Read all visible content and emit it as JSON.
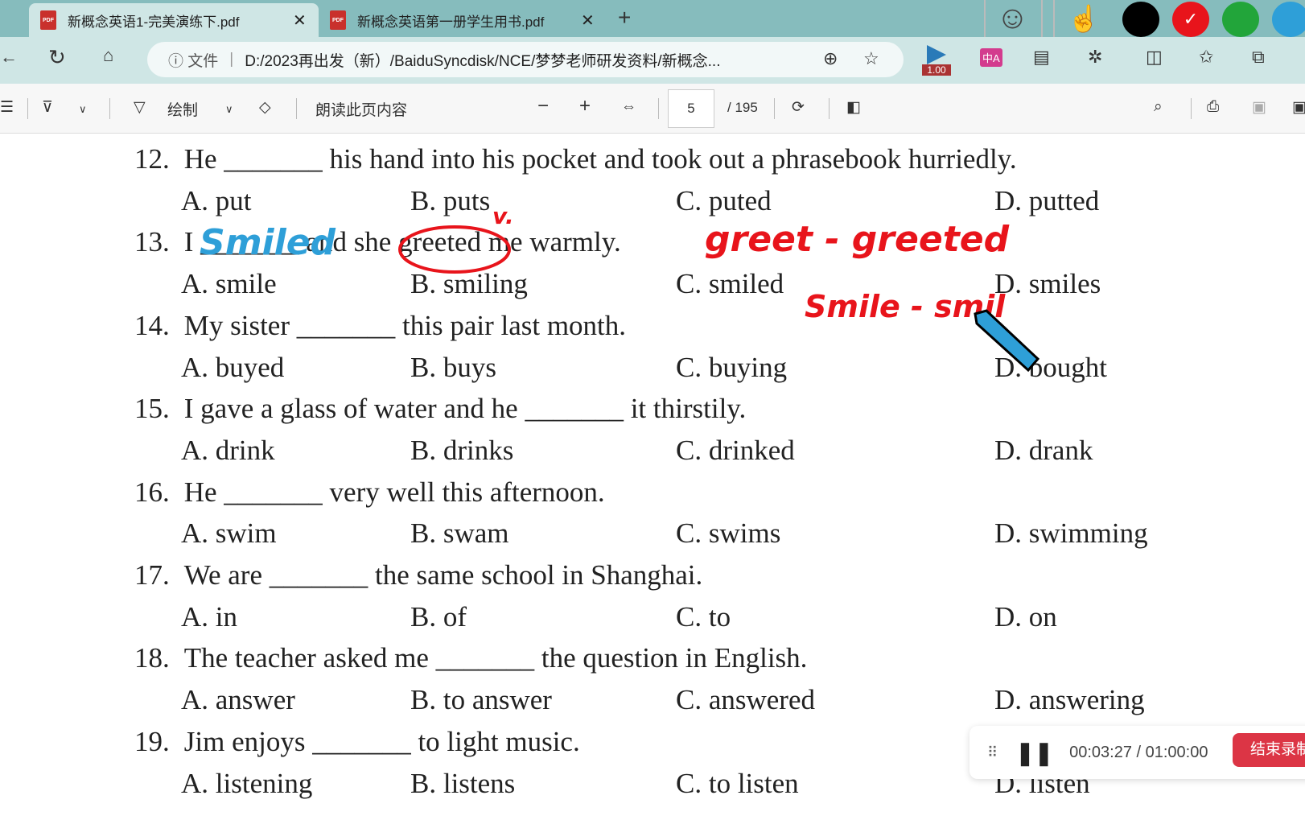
{
  "tabs": [
    {
      "label": "新概念英语1-完美演练下.pdf",
      "active": true
    },
    {
      "label": "新概念英语第一册学生用书.pdf",
      "active": false
    }
  ],
  "address": {
    "info": "文件",
    "url": "D:/2023再出发（新）/BaiduSyncdisk/NCE/梦梦老师研发资料/新概念...",
    "badge": "1.00"
  },
  "toolbar": {
    "draw": "绘制",
    "read_aloud": "朗读此页内容",
    "page": "5",
    "total": "/ 195"
  },
  "colors": {
    "pen_black": "#000000",
    "pen_red": "#e8141b",
    "pen_green": "#22a53a",
    "pen_blue": "#2e9fd8",
    "accent_red": "#dc3545"
  },
  "questions": [
    {
      "num": "12.",
      "stem": "He _______ his hand into his pocket and took out a phrasebook hurriedly.",
      "options": [
        "A. put",
        "B. puts",
        "C. puted",
        "D. putted"
      ]
    },
    {
      "num": "13.",
      "stem": "I _______ and she greeted me warmly.",
      "options": [
        "A. smile",
        "B. smiling",
        "C. smiled",
        "D. smiles"
      ]
    },
    {
      "num": "14.",
      "stem": "My sister _______ this pair last month.",
      "options": [
        "A. buyed",
        "B. buys",
        "C. buying",
        "D. bought"
      ]
    },
    {
      "num": "15.",
      "stem": "I gave a glass of water and he _______ it thirstily.",
      "options": [
        "A. drink",
        "B. drinks",
        "C. drinked",
        "D. drank"
      ]
    },
    {
      "num": "16.",
      "stem": "He _______ very well this afternoon.",
      "options": [
        "A. swim",
        "B. swam",
        "C. swims",
        "D. swimming"
      ]
    },
    {
      "num": "17.",
      "stem": "We are _______ the same school in Shanghai.",
      "options": [
        "A. in",
        "B. of",
        "C. to",
        "D. on"
      ]
    },
    {
      "num": "18.",
      "stem": "The teacher asked me _______ the question in English.",
      "options": [
        "A. answer",
        "B. to answer",
        "C. answered",
        "D. answering"
      ]
    },
    {
      "num": "19.",
      "stem": "Jim enjoys _______ to light music.",
      "options": [
        "A. listening",
        "B. listens",
        "C. to listen",
        "D. listen"
      ]
    }
  ],
  "annotations": {
    "blue": "Smiled",
    "v": "v.",
    "greet": "greet - greeted",
    "smile": "Smile - smil"
  },
  "recorder": {
    "time": "00:03:27 / 01:00:00",
    "end": "结束录制"
  }
}
